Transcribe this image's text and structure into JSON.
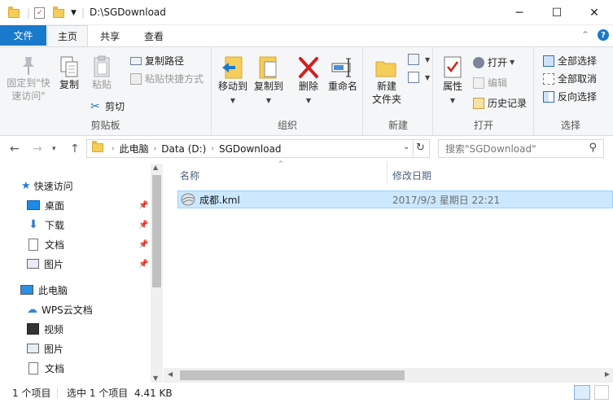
{
  "window": {
    "title": "D:\\SGDownload",
    "minimize": "─",
    "maximize": "☐",
    "close": "✕"
  },
  "tabs": {
    "file": "文件",
    "home": "主页",
    "share": "共享",
    "view": "查看",
    "collapse": "⌃",
    "help": "?"
  },
  "ribbon": {
    "clipboard": {
      "label": "剪贴板",
      "pin": "固定到\"快\n速访问\"",
      "copy": "复制",
      "paste": "粘贴",
      "copy_path": "复制路径",
      "paste_shortcut": "粘贴快捷方式",
      "cut": "剪切"
    },
    "organize": {
      "label": "组织",
      "move_to": "移动到",
      "copy_to": "复制到",
      "delete": "删除",
      "rename": "重命名"
    },
    "new": {
      "label": "新建",
      "new_folder": "新建\n文件夹"
    },
    "open": {
      "label": "打开",
      "properties": "属性",
      "open": "打开",
      "edit": "编辑",
      "history": "历史记录"
    },
    "select": {
      "label": "选择",
      "select_all": "全部选择",
      "select_none": "全部取消",
      "invert": "反向选择"
    }
  },
  "address": {
    "crumbs": [
      "此电脑",
      "Data (D:)",
      "SGDownload"
    ],
    "search_placeholder": "搜索\"SGDownload\""
  },
  "nav": {
    "quick_access": "快速访问",
    "desktop": "桌面",
    "downloads": "下载",
    "documents": "文档",
    "pictures": "图片",
    "this_pc": "此电脑",
    "wps": "WPS云文档",
    "videos": "视频",
    "pictures2": "图片",
    "documents2": "文档"
  },
  "columns": {
    "name": "名称",
    "modified": "修改日期"
  },
  "files": [
    {
      "name": "成都.kml",
      "modified": "2017/9/3 星期日 22:21"
    }
  ],
  "status": {
    "count": "1 个项目",
    "selected": "选中 1 个项目",
    "size": "4.41 KB"
  },
  "colors": {
    "accent": "#1979ca",
    "selection": "#cce8ff",
    "folder": "#f5cd5a"
  }
}
